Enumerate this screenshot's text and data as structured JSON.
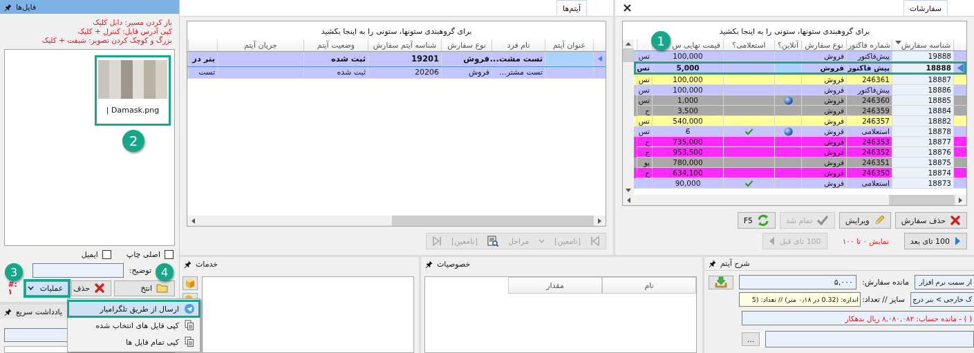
{
  "files_panel": {
    "title": "فایل‌ها",
    "hints": [
      "باز کردن مسیر: دابل کلیک",
      "کپی آدرس فایل: کنترل + کلیک",
      "بزرگ و کوچک کردن تصویر: شیفت + کلیک"
    ],
    "files": [
      {
        "name": "| Damask.png",
        "selected": true,
        "callout": "2"
      }
    ],
    "checkboxes": [
      {
        "label": "اصلی چاپ",
        "checked": false
      },
      {
        "label": "ایمیل",
        "checked": false
      }
    ],
    "description_label": "توضیح:",
    "buttons": [
      {
        "label": "انتخ",
        "kind": "open"
      },
      {
        "label": "حذف",
        "kind": "delete"
      },
      {
        "label": "عملیات",
        "kind": "dropdown",
        "selected": true,
        "callout": "3"
      }
    ],
    "counter": [
      "#:",
      "۱"
    ]
  },
  "operations_menu": {
    "callout": "4",
    "items": [
      {
        "label": "ارسال از طریق تلگرامیار",
        "kind": "send",
        "selected": true
      },
      {
        "label": "کپی فایل های انتخاب شده",
        "kind": "copy",
        "selected": false
      },
      {
        "label": "کپی تمام فایل ها",
        "kind": "copy",
        "selected": false
      }
    ]
  },
  "quick_notes": {
    "title": "یادداشت سریع"
  },
  "items_panel": {
    "tabs": [
      {
        "label": "آیتم‌ها",
        "selected": true
      }
    ],
    "group_hint": "برای گروهبندی ستونها، ستونی را به اینجا بکشید",
    "columns": [
      "عنوان آیتم",
      "نام فرد",
      "نوع سفارش",
      "شناسه آیتم سفارش",
      "وضعیت آیتم",
      "جریان آیتم"
    ],
    "rows": [
      {
        "selected": true,
        "person": "تست مشت...",
        "type": "فروش",
        "item_id": "19201",
        "status": "ثبت شده",
        "column_8": "بنر در"
      },
      {
        "selected": false,
        "person": "تست مشتر...",
        "type": "فروش",
        "item_id": "20206",
        "status": "ثبت شده",
        "column_8": "تست"
      }
    ],
    "pager": {
      "first": "[نامعین]",
      "steps": "مراحل",
      "last": "[نامعین]",
      "disabled": true
    }
  },
  "orders_panel": {
    "tabs": [
      {
        "label": "سفارشات",
        "selected": true
      }
    ],
    "group_hint": "برای گروهبندی ستونها، ستونی را به اینجا بکشید",
    "callout": "1",
    "columns": [
      {
        "label": "شناسه سفارش",
        "sorted": true
      },
      {
        "label": "شماره فاکتور",
        "sorted": false
      },
      {
        "label": "نوع سفارش",
        "sorted": false
      },
      {
        "label": "آنلاین؟",
        "sorted": false
      },
      {
        "label": "استعلامی؟",
        "sorted": false
      },
      {
        "label": "قیمت نهایی س",
        "sorted": false
      }
    ],
    "rows": [
      {
        "color": "#c4c4ff",
        "selected": false,
        "id": "19888",
        "invoice": "پیش‌فاکتور",
        "type": "فروش",
        "online": false,
        "inquiry": false,
        "price": "100,000",
        "column_8": "تس"
      },
      {
        "color": "#c4c4ff",
        "selected": true,
        "id": "18888",
        "invoice": "پیش فاکتور",
        "type": "فروش",
        "online": false,
        "inquiry": false,
        "price": "5,000",
        "column_8": "تس"
      },
      {
        "color": "#ffff99",
        "selected": false,
        "id": "18887",
        "invoice": "246361",
        "type": "فروش",
        "online": false,
        "inquiry": false,
        "price": "100,000",
        "column_8": "تس"
      },
      {
        "color": "#c4c4ff",
        "selected": false,
        "id": "18886",
        "invoice": "پیش‌فاکتور",
        "type": "فروش",
        "online": false,
        "inquiry": false,
        "price": "100,000",
        "column_8": "تس"
      },
      {
        "color": "#a9a9a9",
        "selected": false,
        "id": "18885",
        "invoice": "246360",
        "type": "فروش",
        "online": true,
        "inquiry": false,
        "price": "1,000",
        "column_8": "تس"
      },
      {
        "color": "#a9a9a9",
        "selected": false,
        "id": "18884",
        "invoice": "246359",
        "type": "فروش",
        "online": false,
        "inquiry": false,
        "price": "3,500",
        "column_8": "ح"
      },
      {
        "color": "#ffff99",
        "selected": false,
        "id": "18882",
        "invoice": "246357",
        "type": "فروش",
        "online": false,
        "inquiry": false,
        "price": "540,000",
        "column_8": "تس"
      },
      {
        "color": "#c4c4ff",
        "selected": false,
        "id": "18878",
        "invoice": "استعلامی",
        "type": "فروش",
        "online": true,
        "inquiry": true,
        "price": "6",
        "column_8": "تس"
      },
      {
        "color": "#ff28ff",
        "selected": false,
        "id": "18877",
        "invoice": "246353",
        "type": "فروش",
        "online": false,
        "inquiry": false,
        "price": "735,000",
        "column_8": "ح"
      },
      {
        "color": "#ff28ff",
        "selected": false,
        "id": "18876",
        "invoice": "246352",
        "type": "فروش",
        "online": false,
        "inquiry": false,
        "price": "953,500",
        "column_8": "ح"
      },
      {
        "color": "#a9a9a9",
        "selected": false,
        "id": "18875",
        "invoice": "246351",
        "type": "فروش",
        "online": false,
        "inquiry": false,
        "price": "780,000",
        "column_8": "پو"
      },
      {
        "color": "#ff28ff",
        "selected": false,
        "id": "18874",
        "invoice": "246350",
        "type": "فروش",
        "online": false,
        "inquiry": false,
        "price": "634,100",
        "column_8": "ح"
      },
      {
        "color": "#c4c4ff",
        "selected": false,
        "id": "18873",
        "invoice": "استعلامی",
        "type": "فروش",
        "online": false,
        "inquiry": true,
        "price": "90,000"
      }
    ],
    "buttons": [
      {
        "label": "حذف سفارش",
        "kind": "delete",
        "disabled": false
      },
      {
        "label": "ویرایش",
        "kind": "edit",
        "disabled": false
      },
      {
        "label": "تمام شد",
        "kind": "done",
        "disabled": true
      },
      {
        "label": "F5",
        "kind": "refresh",
        "disabled": false
      }
    ],
    "paging": {
      "next": {
        "label": "100 تای بعد",
        "disabled": false
      },
      "range": "نمایش ۰ تا ۱۰۰",
      "prev": {
        "label": "100 تای قبل",
        "disabled": true
      }
    }
  },
  "services_panel": {
    "title": "خدمات"
  },
  "properties_panel": {
    "title": "خصوصیات",
    "columns": [
      "نام",
      "مقدار"
    ]
  },
  "item_description": {
    "title": "شرح آیتم",
    "fields": [
      {
        "label": "مانده سفارش:",
        "value": "۵,۰۰۰",
        "side_value": "از سمت نرم افزار",
        "kind": "plain"
      },
      {
        "label": "سایز // تعداد:",
        "value": "اندازه: (0.32 در ۰٫۱۸ متر) // تعداد: (5",
        "side_value": "ک خارجی > بنر درج",
        "kind": "note"
      }
    ],
    "balance": "( ) - مانده حساب: ۸,۰۸۰,۰۸۲ ریال بدهکار",
    "more_button": "..."
  }
}
